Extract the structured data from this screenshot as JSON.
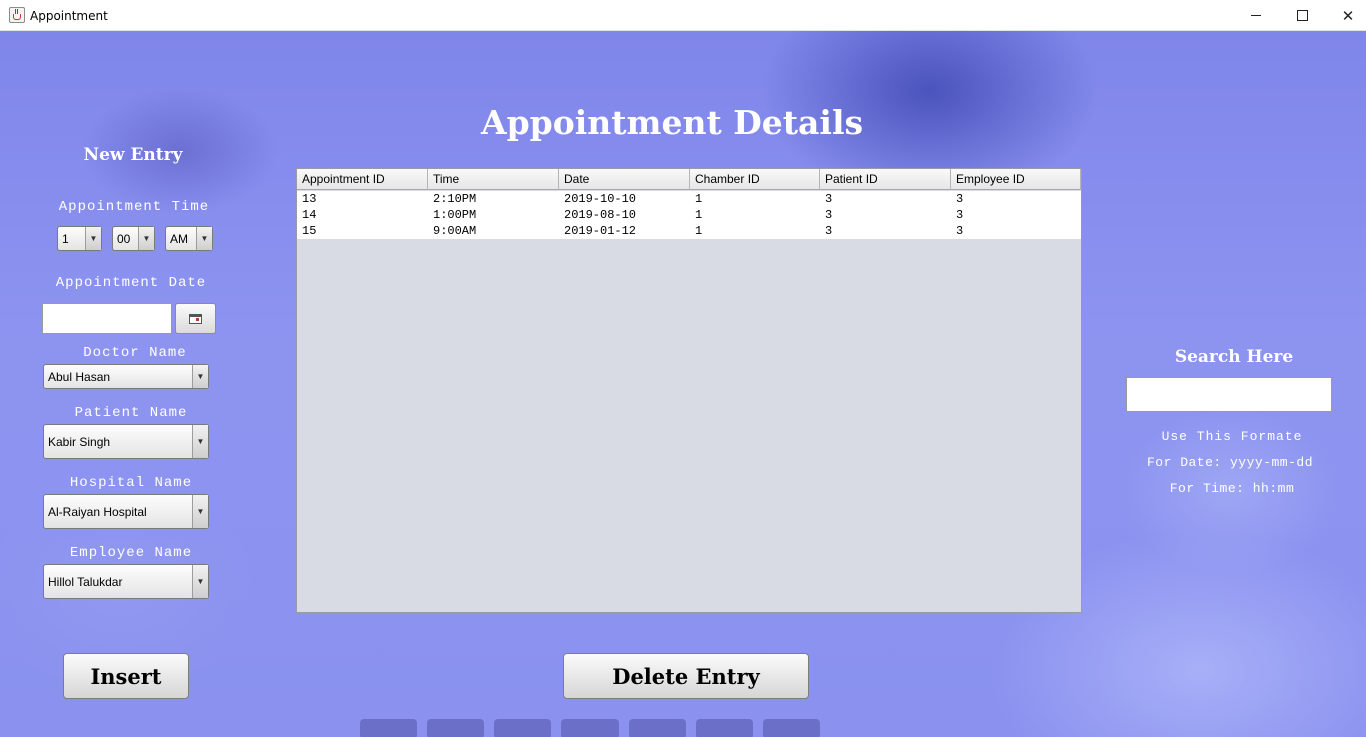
{
  "window": {
    "title": "Appointment",
    "controls": {
      "minimize_icon": "minimize-icon",
      "maximize_icon": "maximize-icon",
      "close_glyph": "✕"
    }
  },
  "header": {
    "title": "Appointment Details"
  },
  "new_entry": {
    "heading": "New Entry",
    "time_label": "Appointment Time",
    "time": {
      "hour": "1",
      "minute": "00",
      "ampm": "AM"
    },
    "date_label": "Appointment Date",
    "date_value": "",
    "doctor_label": "Doctor Name",
    "doctor_value": "Abul Hasan",
    "patient_label": "Patient Name",
    "patient_value": "Kabir Singh",
    "hospital_label": "Hospital Name",
    "hospital_value": "Al-Raiyan Hospital",
    "employee_label": "Employee Name",
    "employee_value": "Hillol Talukdar"
  },
  "table": {
    "columns": [
      "Appointment ID",
      "Time",
      "Date",
      "Chamber ID",
      "Patient ID",
      "Employee ID"
    ],
    "rows": [
      [
        "13",
        "2:10PM",
        "2019-10-10",
        "1",
        "3",
        "3"
      ],
      [
        "14",
        "1:00PM",
        "2019-08-10",
        "1",
        "3",
        "3"
      ],
      [
        "15",
        "9:00AM",
        "2019-01-12",
        "1",
        "3",
        "3"
      ]
    ]
  },
  "search": {
    "heading": "Search Here",
    "value": "",
    "hint_title": "Use This Formate",
    "hint_date": "For Date: yyyy-mm-dd",
    "hint_time": "For Time: hh:mm"
  },
  "actions": {
    "insert_label": "Insert",
    "delete_label": "Delete Entry"
  },
  "icons": {
    "dropdown_arrow": "▼"
  }
}
